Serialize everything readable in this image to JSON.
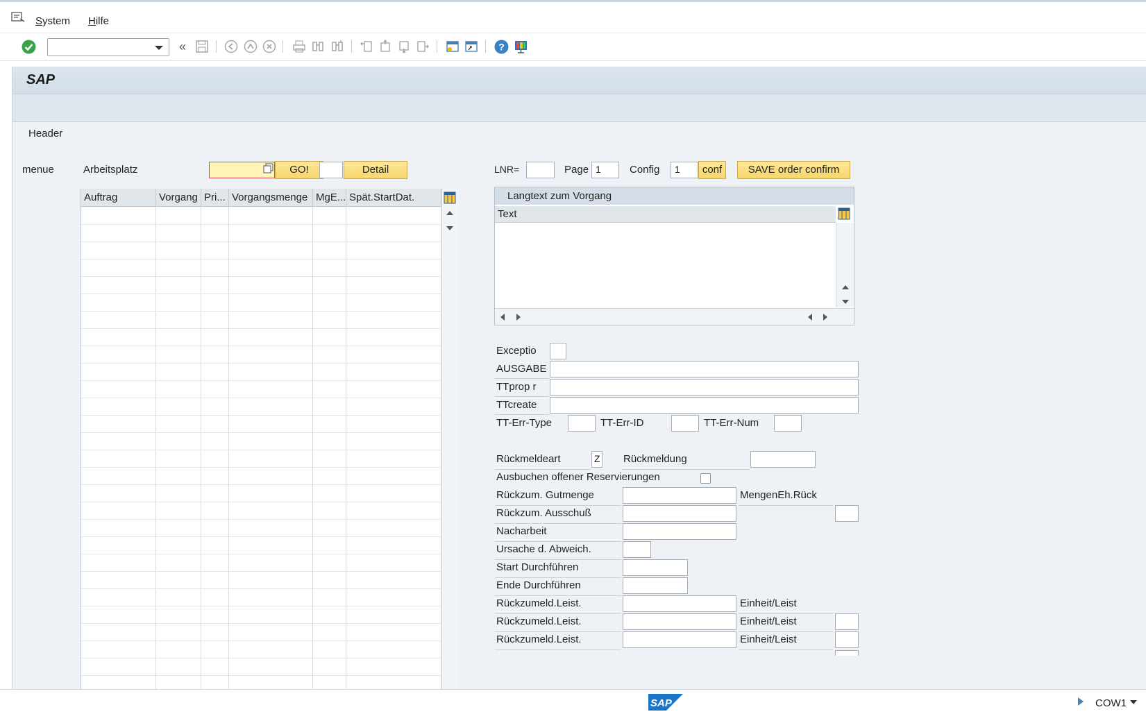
{
  "menu": {
    "items": [
      "System",
      "Hilfe"
    ]
  },
  "toolbar": {
    "command_value": ""
  },
  "title": "SAP",
  "header_label": "Header",
  "menue_label": "menue",
  "arbeitsplatz": {
    "label": "Arbeitsplatz",
    "value": "",
    "go_label": "GO!",
    "extra_value": "",
    "detail_label": "Detail"
  },
  "top_right": {
    "lnr_label": "LNR=",
    "lnr_value": "",
    "page_label": "Page",
    "page_value": "1",
    "config_label": "Config",
    "config_value": "1",
    "conf_label": "conf",
    "save_label": "SAVE order confirm"
  },
  "grid": {
    "columns": [
      "Auftrag",
      "Vorgang",
      "Pri...",
      "Vorgangsmenge",
      "MgE...",
      "Spät.StartDat."
    ]
  },
  "langtext": {
    "title": "Langtext zum Vorgang",
    "column": "Text"
  },
  "form": {
    "exceptio": "Exceptio",
    "ausgabe": "AUSGABE",
    "ttprop": "TTprop r",
    "ttcreate": "TTcreate",
    "tt_err_type": "TT-Err-Type",
    "tt_err_id": "TT-Err-ID",
    "tt_err_num": "TT-Err-Num",
    "rueckmeldeart": "Rückmeldeart",
    "rueckmeldeart_value": "Z",
    "rueckmeldung": "Rückmeldung",
    "ausbuchen": "Ausbuchen offener Reservierungen",
    "gutmenge": "Rückzum. Gutmenge",
    "mengeneh": "MengenEh.Rück",
    "ausschuss": "Rückzum. Ausschuß",
    "nacharbeit": "Nacharbeit",
    "ursache": "Ursache d. Abweich.",
    "start": "Start Durchführen",
    "ende": "Ende Durchführen",
    "leist1": "Rückzumeld.Leist.",
    "leist2": "Rückzumeld.Leist.",
    "leist3": "Rückzumeld.Leist.",
    "einheit1": "Einheit/Leist",
    "einheit2": "Einheit/Leist",
    "einheit3": "Einheit/Leist"
  },
  "status": {
    "system": "COW1"
  },
  "icons": [
    "menu-icon",
    "enter-icon",
    "back-icon",
    "save-icon",
    "previous-icon",
    "next-icon",
    "cancel-icon",
    "print-icon",
    "find-icon",
    "find-next-icon",
    "first-page-icon",
    "prev-page-icon",
    "next-page-icon",
    "last-page-icon",
    "new-session-icon",
    "shortcut-icon",
    "help-icon",
    "customize-icon",
    "layout-icon",
    "sap-logo"
  ],
  "colors": {
    "accent_yellow": "#f7d66a",
    "panel": "#eef2f6",
    "title_bar": "#d2dde8",
    "ok_green": "#3aa34a",
    "sap_blue": "#1a75c9"
  }
}
